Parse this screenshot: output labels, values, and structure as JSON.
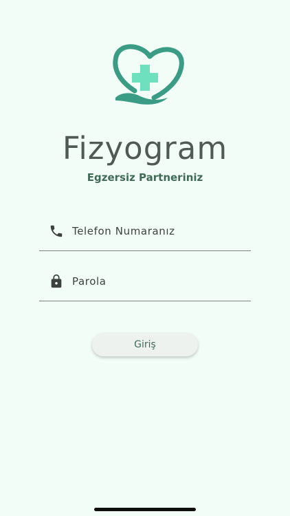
{
  "app": {
    "title": "Fizyogram",
    "subtitle": "Egzersiz Partneriniz",
    "logo_icon": "heart-medical-cross-hand-icon"
  },
  "form": {
    "phone": {
      "icon": "phone-icon",
      "placeholder": "Telefon Numaranız",
      "value": ""
    },
    "password": {
      "icon": "lock-icon",
      "placeholder": "Parola",
      "value": ""
    },
    "submit_label": "Giriş"
  },
  "colors": {
    "background": "#f3fdf7",
    "logo_teal": "#3a9c85",
    "cross_mint": "#6ee0be",
    "title": "#4f5a56",
    "accent": "#3f6b56"
  }
}
